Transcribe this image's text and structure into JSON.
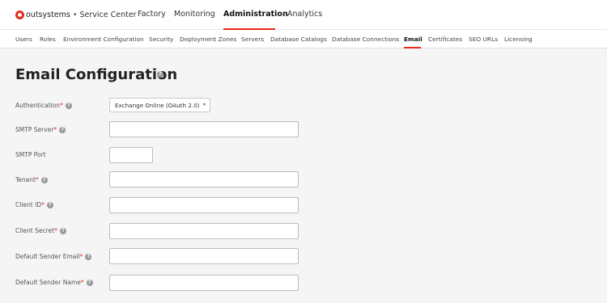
{
  "brand": {
    "name": "outsystems",
    "separator": "•",
    "product": "Service Center",
    "accent_color": "#e42b18"
  },
  "main_nav": [
    {
      "label": "Factory"
    },
    {
      "label": "Monitoring"
    },
    {
      "label": "Administration",
      "active": true
    },
    {
      "label": "Analytics"
    }
  ],
  "sub_nav": [
    {
      "label": "Users"
    },
    {
      "label": "Roles"
    },
    {
      "label": "Environment Configuration"
    },
    {
      "label": "Security"
    },
    {
      "label": "Deployment Zones"
    },
    {
      "label": "Servers"
    },
    {
      "label": "Database Catalogs"
    },
    {
      "label": "Database Connections"
    },
    {
      "label": "Email",
      "active": true
    },
    {
      "label": "Certificates"
    },
    {
      "label": "SEO URLs"
    },
    {
      "label": "Licensing"
    }
  ],
  "page": {
    "title": "Email Configuration",
    "help_icon": "help-icon"
  },
  "form": {
    "authentication": {
      "label": "Authentication",
      "value": "Exchange Online (OAuth 2.0)"
    },
    "smtp_server": {
      "label": "SMTP Server",
      "value": ""
    },
    "smtp_port": {
      "label": "SMTP Port",
      "value": ""
    },
    "tenant": {
      "label": "Tenant",
      "value": ""
    },
    "client_id": {
      "label": "Client ID",
      "value": ""
    },
    "client_secret": {
      "label": "Client Secret",
      "value": ""
    },
    "default_sender_email": {
      "label": "Default Sender Email",
      "value": ""
    },
    "default_sender_name": {
      "label": "Default Sender Name",
      "value": ""
    },
    "required_marker": "*",
    "help_glyph": "?"
  }
}
